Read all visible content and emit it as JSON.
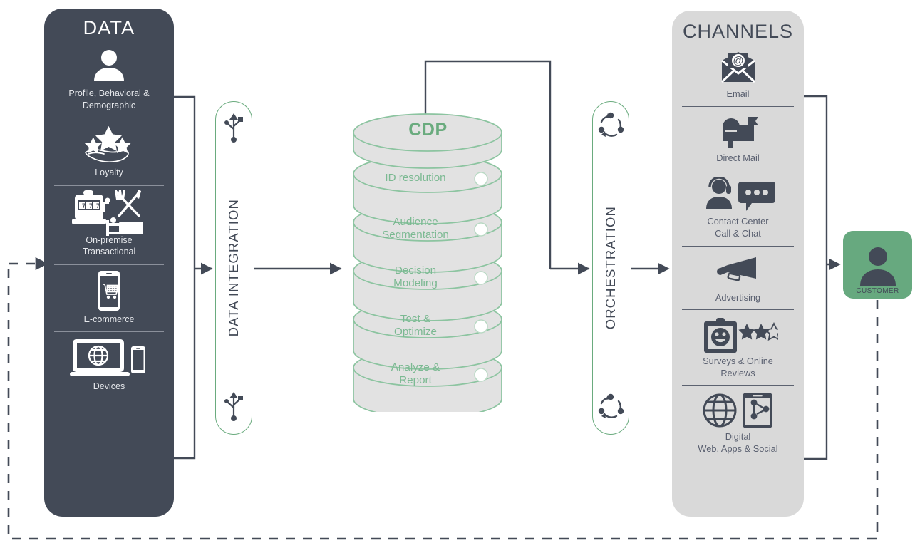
{
  "diagram": {
    "title": "Customer Data Platform flow diagram",
    "colors": {
      "dark_panel": "#434a57",
      "light_panel": "#d9d9d9",
      "accent_green": "#6aab7e",
      "customer_green": "#67a97f",
      "cylinder_fill": "#e2e2e2",
      "cylinder_stroke": "#8cc4a0",
      "connector": "#434a57"
    }
  },
  "data_panel": {
    "title": "DATA",
    "items": [
      {
        "label": "Profile, Behavioral &\nDemographic",
        "icon": "person-icon"
      },
      {
        "label": "Loyalty",
        "icon": "stars-hand-icon"
      },
      {
        "label": "On-premise\nTransactional",
        "icon": "slot-machine-dining-bed-icon"
      },
      {
        "label": "E-commerce",
        "icon": "phone-shopping-cart-icon"
      },
      {
        "label": "Devices",
        "icon": "laptop-globe-phone-icon"
      }
    ]
  },
  "integration_pillar": {
    "label": "DATA INTEGRATION",
    "top_icon": "usb-icon",
    "bottom_icon": "usb-icon"
  },
  "cdp": {
    "title": "CDP",
    "layers": [
      {
        "label": "ID resolution",
        "bullet": "status-dot"
      },
      {
        "label": "Audience\nSegmentation",
        "bullet": "status-dot"
      },
      {
        "label": "Decision\nModeling",
        "bullet": "status-dot"
      },
      {
        "label": "Test &\nOptimize",
        "bullet": "status-dot"
      },
      {
        "label": "Analyze &\nReport",
        "bullet": "status-dot"
      }
    ]
  },
  "orchestration_pillar": {
    "label": "ORCHESTRATION",
    "top_icon": "cycle-arrows-icon",
    "bottom_icon": "cycle-arrows-icon"
  },
  "channels_panel": {
    "title": "CHANNELS",
    "items": [
      {
        "label": "Email",
        "icon": "envelope-at-icon"
      },
      {
        "label": "Direct Mail",
        "icon": "mailbox-icon"
      },
      {
        "label": "Contact Center\nCall & Chat",
        "icon": "headset-person-chat-icon"
      },
      {
        "label": "Advertising",
        "icon": "megaphone-icon"
      },
      {
        "label": "Surveys & Online\nReviews",
        "icon": "clipboard-smiley-stars-icon"
      },
      {
        "label": "Digital\nWeb, Apps & Social",
        "icon": "globe-phone-social-icon"
      }
    ]
  },
  "customer": {
    "label": "CUSTOMER",
    "icon": "person-icon"
  },
  "flows": [
    {
      "name": "data-to-integration",
      "style": "solid",
      "from": "DATA",
      "to": "DATA INTEGRATION"
    },
    {
      "name": "integration-to-cdp",
      "style": "solid",
      "from": "DATA INTEGRATION",
      "to": "CDP"
    },
    {
      "name": "cdp-to-orchestration",
      "style": "solid",
      "from": "CDP",
      "to": "ORCHESTRATION"
    },
    {
      "name": "orchestration-to-channels",
      "style": "solid",
      "from": "ORCHESTRATION",
      "to": "CHANNELS"
    },
    {
      "name": "channels-to-customer",
      "style": "solid",
      "from": "CHANNELS",
      "to": "CUSTOMER"
    },
    {
      "name": "customer-to-data-feedback",
      "style": "dashed",
      "from": "CUSTOMER",
      "to": "DATA"
    }
  ]
}
